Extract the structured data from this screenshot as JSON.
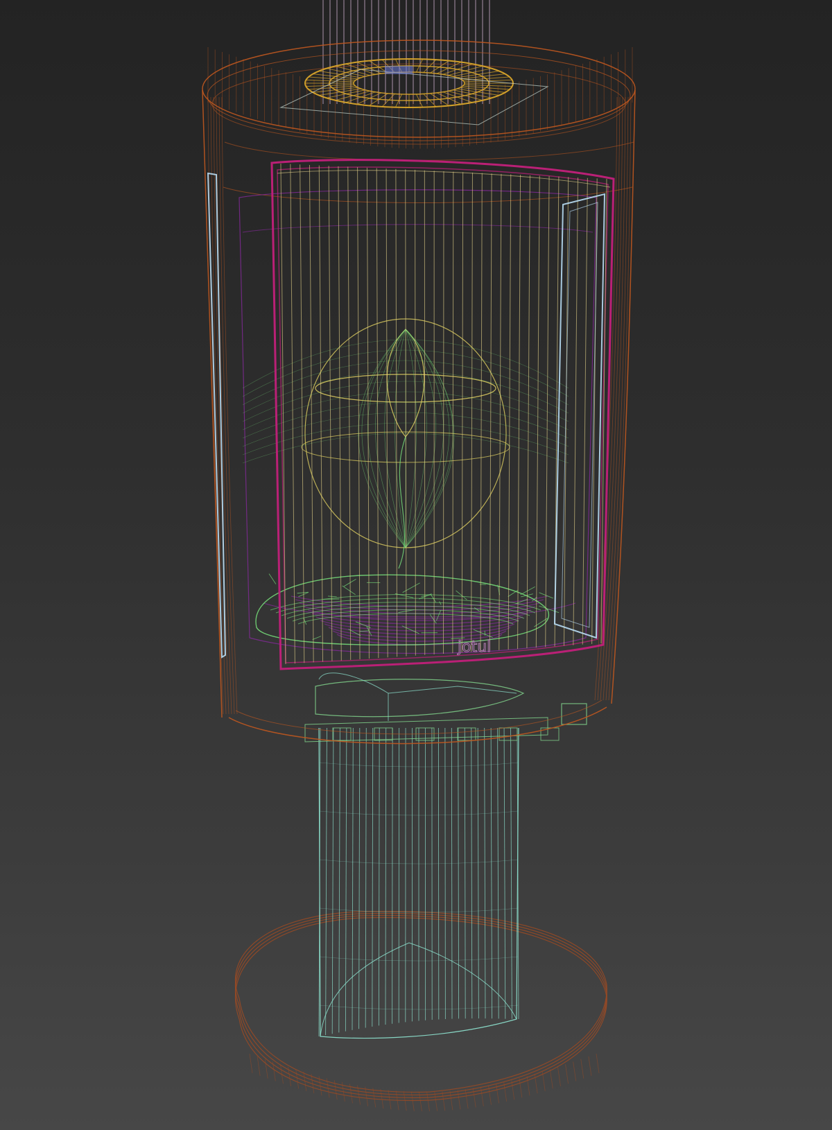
{
  "viewport": {
    "background_top": "#232323",
    "background_bottom": "#474747"
  },
  "model": {
    "logo_text": "jotul",
    "wire_colors": {
      "body": "#c0581f",
      "top_ring": "#d9a52a",
      "flue": "#d8b8d8",
      "door_frame": "#c2207a",
      "glass": "#e6d48a",
      "fire_logs": "#77e07a",
      "flame": "#e0d060",
      "inner_firebox": "#8a2aa0",
      "side_window": "#bfe6ff",
      "pedestal": "#8fe6d2",
      "base_plate": "#9a4a24",
      "ash_tray": "#7fd08a"
    }
  }
}
